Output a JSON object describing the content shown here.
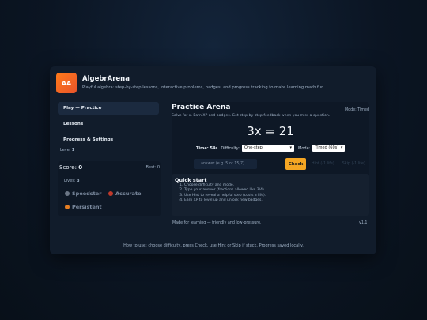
{
  "app": {
    "logo_text": "AA",
    "title": "AlgebrArena",
    "subtitle": "Playful algebra: step-by-step lessons, interactive problems, badges, and progress tracking to make learning math fun."
  },
  "sidebar": {
    "items": [
      {
        "label": "Play — Practice",
        "active": true
      },
      {
        "label": "Lessons",
        "active": false
      },
      {
        "label": "Progress & Settings",
        "active": false
      }
    ],
    "level_label": "Level",
    "level_value": "1"
  },
  "stats": {
    "score_label": "Score:",
    "score_value": "0",
    "best_label": "Best:",
    "best_value": "0",
    "lives_label": "Lives:",
    "lives_value": "3",
    "badges": [
      {
        "label": "Speedster",
        "icon": "stopwatch-icon",
        "color": "#6b7686"
      },
      {
        "label": "Accurate",
        "icon": "target-icon",
        "color": "#c0392b"
      },
      {
        "label": "Persistent",
        "icon": "fire-icon",
        "color": "#e67e22"
      }
    ]
  },
  "practice": {
    "title": "Practice Arena",
    "subtitle": "Solve for x. Earn XP and badges. Get step-by-step feedback when you miss a question.",
    "mode_label": "Mode: Timed",
    "equation": "3x = 21",
    "time_label": "Time: 54s",
    "difficulty_label": "Difficulty:",
    "difficulty_value": "One-step",
    "mode_select_label": "Mode:",
    "mode_value": "Timed (60s)",
    "answer_placeholder": "answer (e.g. 5 or 15/7)",
    "check_label": "Check",
    "hint_label": "Hint (-1 life)",
    "skip_label": "Skip (-1 life)"
  },
  "quick_start": {
    "title": "Quick start",
    "steps": [
      "Choose difficulty and mode.",
      "Type your answer (fractions allowed like 3/4).",
      "Use Hint to reveal a helpful step (costs a life).",
      "Earn XP to level up and unlock new badges."
    ]
  },
  "footer": {
    "tagline": "Made for learning — friendly and low-pressure.",
    "version": "v1.1",
    "how_to": "How to use: choose difficulty, press Check, use Hint or Skip if stuck. Progress saved locally."
  },
  "colors": {
    "accent": "#f5a623",
    "logo": "#f26a22",
    "background": "#0b1523",
    "card": "#111c2b"
  }
}
